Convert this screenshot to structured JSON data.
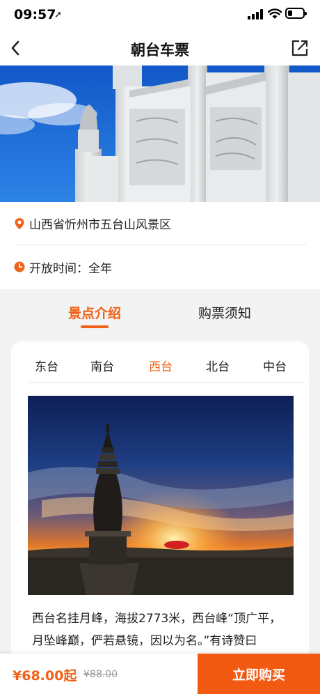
{
  "status_bar": {
    "time": "09:57",
    "battery_level": 0.3
  },
  "nav": {
    "title": "朝台车票"
  },
  "info": {
    "location": "山西省忻州市五台山风景区",
    "hours": "开放时间：全年"
  },
  "tabs": [
    {
      "label": "景点介绍",
      "active": true
    },
    {
      "label": "购票须知",
      "active": false
    }
  ],
  "sub_tabs": [
    {
      "label": "东台",
      "active": false
    },
    {
      "label": "南台",
      "active": false
    },
    {
      "label": "西台",
      "active": true
    },
    {
      "label": "北台",
      "active": false
    },
    {
      "label": "中台",
      "active": false
    }
  ],
  "description": "西台名挂月峰，海拔2773米，西台峰“顶广平，月坠峰巅，俨若悬镜，因以为名。”有诗赞曰",
  "bottom": {
    "price": "¥68.00起",
    "original_price": "¥88.00",
    "buy_label": "立即购买"
  },
  "colors": {
    "accent": "#f06016",
    "buy_button": "#f25a12",
    "sky": "#1e6fd6"
  },
  "icons": [
    "back-arrow-icon",
    "share-icon",
    "location-pin-icon",
    "clock-icon"
  ]
}
